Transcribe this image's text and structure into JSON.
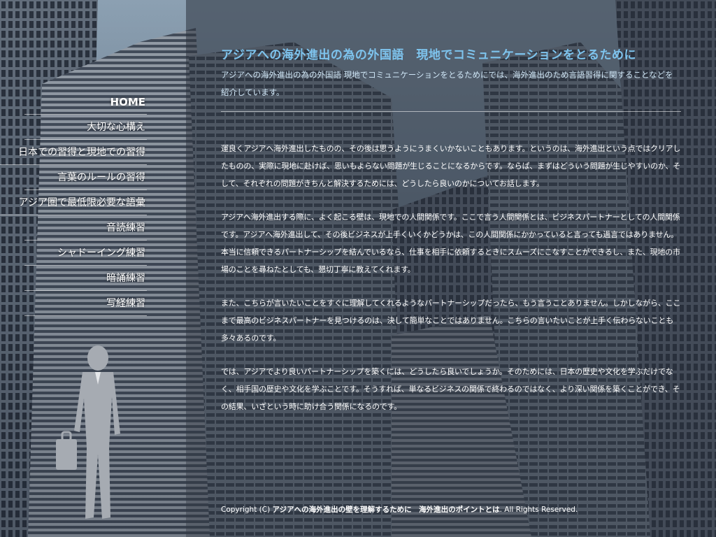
{
  "nav": {
    "items": [
      {
        "label": "HOME"
      },
      {
        "label": "大切な心構え"
      },
      {
        "label": "日本での習得と現地での習得"
      },
      {
        "label": "言葉のルールの習得"
      },
      {
        "label": "アジア圏で最低限必要な語彙"
      },
      {
        "label": "音読練習"
      },
      {
        "label": "シャドーイング練習"
      },
      {
        "label": "暗誦練習"
      },
      {
        "label": "写経練習"
      }
    ]
  },
  "main": {
    "title": "アジアへの海外進出の為の外国語　現地でコミュニケーションをとるために",
    "intro": "アジアへの海外進出の為の外国語 現地でコミュニケーションをとるためにでは、海外進出のため言語習得に関することなどを紹介しています。",
    "paragraphs": [
      "運良くアジアへ海外進出したものの、その後は思うようにうまくいかないこともあります。というのは、海外進出という点ではクリアしたものの、実際に現地に赴けば、思いもよらない問題が生じることになるからです。ならば、まずはどういう問題が生じやすいのか、そして、それぞれの問題がきちんと解決するためには、どうしたら良いのかについてお話します。",
      "アジアへ海外進出する際に、よく起こる壁は、現地での人間関係です。ここで言う人間関係とは、ビジネスパートナーとしての人間関係です。アジアへ海外進出して、その後ビジネスが上手くいくかどうかは、この人間関係にかかっていると言っても過言ではありません。本当に信頼できるパートナーシップを結んでいるなら、仕事を相手に依頼するときにスムーズにこなすことができるし、また、現地の市場のことを尋ねたとしても、懇切丁寧に教えてくれます。",
      "また、こちらが言いたいことをすぐに理解してくれるようなパートナーシップだったら、もう言うことありません。しかしながら、ここまで最高のビジネスパートナーを見つけるのは、決して簡単なことではありません。こちらの言いたいことが上手く伝わらないことも多々あるのです。",
      "では、アジアでより良いパートナーシップを築くには、どうしたら良いでしょうか。そのためには、日本の歴史や文化を学ぶだけでなく、相手国の歴史や文化を学ぶことです。そうすれば、単なるビジネスの関係で終わるのではなく、より深い関係を築くことができ、その結果、いざという時に助け合う関係になるのです。"
    ]
  },
  "footer": {
    "prefix": "Copyright (C) ",
    "link1": "アジアへの海外進出の壁を理解するために",
    "sep": "　",
    "link2": "海外進出のポイントとは",
    "suffix": ". All Rights Reserved."
  },
  "colors": {
    "title": "#7ec4ee",
    "intro": "#cfe6f6",
    "panel": "#3a404c"
  },
  "images": {
    "background": "city-skyscrapers-photo",
    "figure": "businessman-silhouette"
  }
}
